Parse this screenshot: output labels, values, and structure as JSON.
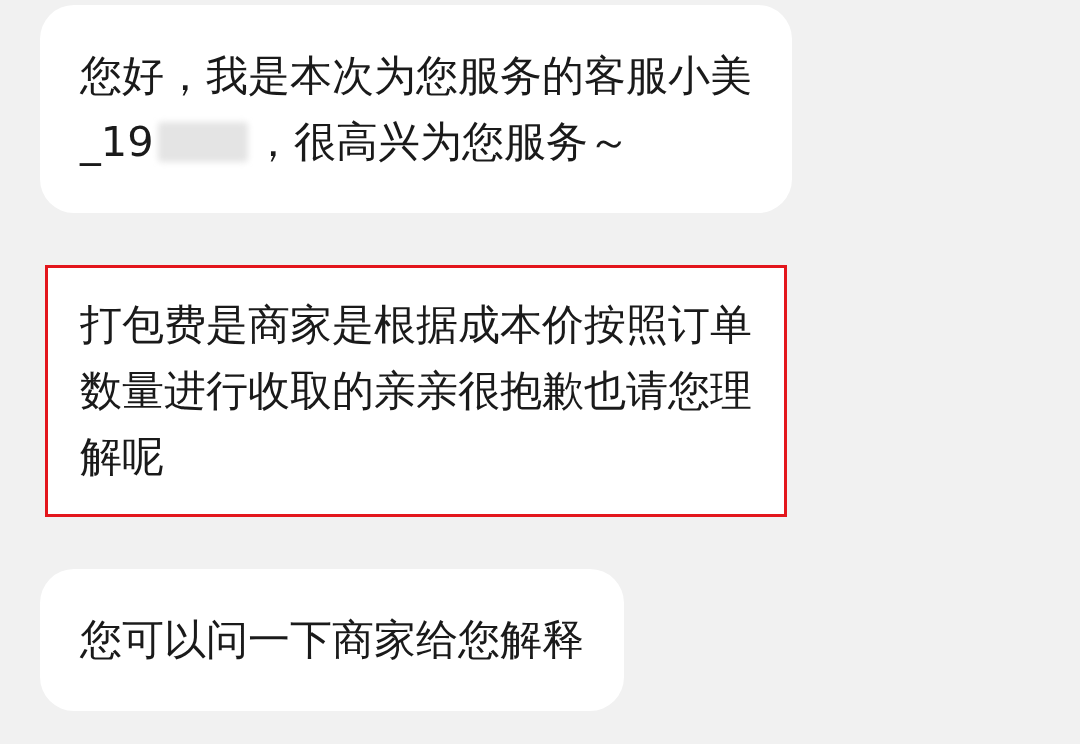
{
  "messages": [
    {
      "highlighted": false,
      "parts": [
        {
          "kind": "text",
          "text": "您好，我是本次为您服务的客服小美"
        },
        {
          "kind": "text",
          "text": "_19"
        },
        {
          "kind": "redacted"
        },
        {
          "kind": "text",
          "text": "，很高兴为您服务～"
        }
      ]
    },
    {
      "highlighted": true,
      "parts": [
        {
          "kind": "text",
          "text": "打包费是商家是根据成本价按照订单数量进行收取的亲亲很抱歉也请您理解呢"
        }
      ]
    },
    {
      "highlighted": false,
      "parts": [
        {
          "kind": "text",
          "text": "您可以问一下商家给您解释"
        }
      ]
    }
  ]
}
